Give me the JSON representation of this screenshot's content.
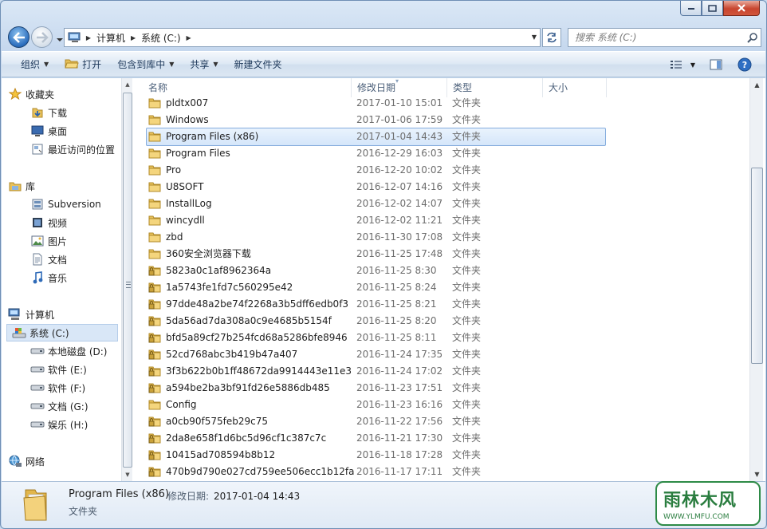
{
  "window": {
    "address": {
      "crumbs": [
        "计算机",
        "系统 (C:)"
      ]
    },
    "search": {
      "placeholder": "搜索 系统 (C:)"
    }
  },
  "toolbar": {
    "organize": "组织",
    "open": "打开",
    "include_library": "包含到库中",
    "share": "共享",
    "new_folder": "新建文件夹"
  },
  "sidebar": {
    "favorites_label": "收藏夹",
    "favorites": [
      "下载",
      "桌面",
      "最近访问的位置"
    ],
    "libraries_label": "库",
    "libraries": [
      "Subversion",
      "视频",
      "图片",
      "文档",
      "音乐"
    ],
    "computer_label": "计算机",
    "drives": [
      "系统 (C:)",
      "本地磁盘 (D:)",
      "软件 (E:)",
      "软件 (F:)",
      "文档 (G:)",
      "娱乐 (H:)"
    ],
    "network_label": "网络"
  },
  "columns": {
    "name": "名称",
    "date": "修改日期",
    "type": "类型",
    "size": "大小"
  },
  "files": [
    {
      "name": "pldtx007",
      "date": "2017-01-10 15:01",
      "type": "文件夹",
      "locked": false
    },
    {
      "name": "Windows",
      "date": "2017-01-06 17:59",
      "type": "文件夹",
      "locked": false
    },
    {
      "name": "Program Files (x86)",
      "date": "2017-01-04 14:43",
      "type": "文件夹",
      "locked": false,
      "selected": true
    },
    {
      "name": "Program Files",
      "date": "2016-12-29 16:03",
      "type": "文件夹",
      "locked": false
    },
    {
      "name": "Pro",
      "date": "2016-12-20 10:02",
      "type": "文件夹",
      "locked": false
    },
    {
      "name": "U8SOFT",
      "date": "2016-12-07 14:16",
      "type": "文件夹",
      "locked": false
    },
    {
      "name": "InstallLog",
      "date": "2016-12-02 14:07",
      "type": "文件夹",
      "locked": false
    },
    {
      "name": "wincydll",
      "date": "2016-12-02 11:21",
      "type": "文件夹",
      "locked": false
    },
    {
      "name": "zbd",
      "date": "2016-11-30 17:08",
      "type": "文件夹",
      "locked": false
    },
    {
      "name": "360安全浏览器下载",
      "date": "2016-11-25 17:48",
      "type": "文件夹",
      "locked": false
    },
    {
      "name": "5823a0c1af8962364a",
      "date": "2016-11-25 8:30",
      "type": "文件夹",
      "locked": true
    },
    {
      "name": "1a5743fe1fd7c560295e42",
      "date": "2016-11-25 8:24",
      "type": "文件夹",
      "locked": true
    },
    {
      "name": "97dde48a2be74f2268a3b5dff6edb0f3",
      "date": "2016-11-25 8:21",
      "type": "文件夹",
      "locked": true
    },
    {
      "name": "5da56ad7da308a0c9e4685b5154f",
      "date": "2016-11-25 8:20",
      "type": "文件夹",
      "locked": true
    },
    {
      "name": "bfd5a89cf27b254fcd68a5286bfe8946",
      "date": "2016-11-25 8:11",
      "type": "文件夹",
      "locked": true
    },
    {
      "name": "52cd768abc3b419b47a407",
      "date": "2016-11-24 17:35",
      "type": "文件夹",
      "locked": true
    },
    {
      "name": "3f3b622b0b1ff48672da9914443e11e3",
      "date": "2016-11-24 17:02",
      "type": "文件夹",
      "locked": true
    },
    {
      "name": "a594be2ba3bf91fd26e5886db485",
      "date": "2016-11-23 17:51",
      "type": "文件夹",
      "locked": true
    },
    {
      "name": "Config",
      "date": "2016-11-23 16:16",
      "type": "文件夹",
      "locked": false
    },
    {
      "name": "a0cb90f575feb29c75",
      "date": "2016-11-22 17:56",
      "type": "文件夹",
      "locked": true
    },
    {
      "name": "2da8e658f1d6bc5d96cf1c387c7c",
      "date": "2016-11-21 17:30",
      "type": "文件夹",
      "locked": true
    },
    {
      "name": "10415ad708594b8b12",
      "date": "2016-11-18 17:28",
      "type": "文件夹",
      "locked": true
    },
    {
      "name": "470b9d790e027cd759ee506ecc1b12fa",
      "date": "2016-11-17 17:11",
      "type": "文件夹",
      "locked": true
    }
  ],
  "details": {
    "name": "Program Files (x86)",
    "modified_label": "修改日期:",
    "modified_value": "2017-01-04 14:43",
    "type": "文件夹"
  },
  "watermark": {
    "text": "雨林木风",
    "url": "WWW.YLMFU.COM"
  },
  "colors": {
    "accent": "#2b6dbd",
    "selection": "#d5e6fa",
    "folder": "#e8c15a"
  }
}
